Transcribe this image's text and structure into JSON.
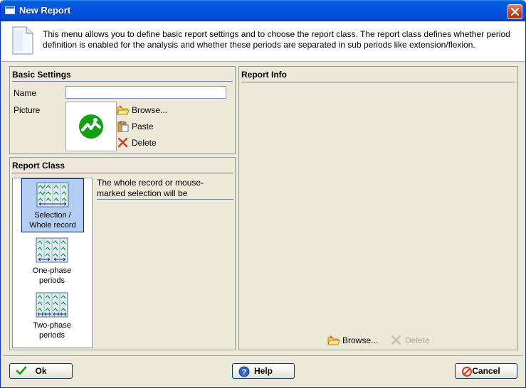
{
  "window": {
    "title": "New Report",
    "icon": "window-icon",
    "close_icon": "close-icon"
  },
  "info": {
    "icon": "document-icon",
    "text": "This menu allows you to define basic report settings and to choose the report class. The report class defines whether period definition is enabled for the analysis and whether these periods are separated in sub periods like extension/flexion."
  },
  "basic_settings": {
    "title": "Basic Settings",
    "name_label": "Name",
    "name_value": "",
    "picture_label": "Picture",
    "picture_icon": "report-logo-icon",
    "browse_label": "Browse...",
    "paste_label": "Paste",
    "delete_label": "Delete"
  },
  "report_class": {
    "title": "Report Class",
    "items": [
      {
        "label_line1": "Selection /",
        "label_line2": "Whole record",
        "icon": "selection-whole-record-icon",
        "selected": true
      },
      {
        "label_line1": "One-phase",
        "label_line2": "periods",
        "icon": "one-phase-periods-icon",
        "selected": false
      },
      {
        "label_line1": "Two-phase",
        "label_line2": "periods",
        "icon": "two-phase-periods-icon",
        "selected": false
      }
    ],
    "description": "The whole record or mouse-marked selection will be"
  },
  "report_info": {
    "title": "Report Info",
    "browse_label": "Browse...",
    "delete_label": "Delete",
    "delete_enabled": false
  },
  "buttons": {
    "ok_label": "Ok",
    "help_label": "Help",
    "cancel_label": "Cancel"
  },
  "colors": {
    "titlebar": "#0054e3",
    "dialog_background": "#ece9d8",
    "selection": "#b4cdf3",
    "accent_green": "#14a014",
    "delete_red": "#d23a1e"
  }
}
